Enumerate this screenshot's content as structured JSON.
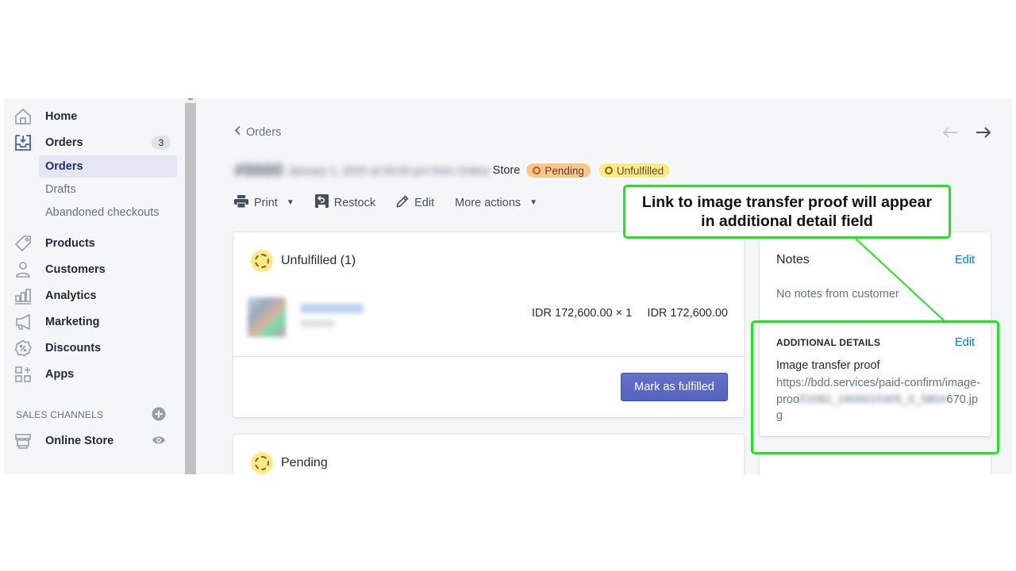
{
  "sidebar": {
    "items": [
      {
        "label": "Home",
        "icon": "home-icon"
      },
      {
        "label": "Orders",
        "icon": "orders-icon",
        "badge": "3"
      },
      {
        "label": "Products",
        "icon": "tag-icon"
      },
      {
        "label": "Customers",
        "icon": "person-icon"
      },
      {
        "label": "Analytics",
        "icon": "bar-chart-icon"
      },
      {
        "label": "Marketing",
        "icon": "megaphone-icon"
      },
      {
        "label": "Discounts",
        "icon": "discount-icon"
      },
      {
        "label": "Apps",
        "icon": "apps-icon"
      }
    ],
    "orders_sub": [
      {
        "label": "Orders"
      },
      {
        "label": "Drafts"
      },
      {
        "label": "Abandoned checkouts"
      }
    ],
    "sales_channels_title": "SALES CHANNELS",
    "online_store": "Online Store"
  },
  "header": {
    "breadcrumb": "Orders",
    "order_number_blurred": "#0000",
    "order_date_blurred": "January 1, 2020 at 00:00 pm from Online",
    "store_suffix": "Store",
    "statuses": [
      "Pending",
      "Unfulfilled"
    ]
  },
  "actions": {
    "print": "Print",
    "restock": "Restock",
    "edit": "Edit",
    "more": "More actions"
  },
  "unfulfilled": {
    "title": "Unfulfilled (1)",
    "item_price": "IDR 172,600.00 × 1",
    "item_total": "IDR 172,600.00",
    "button": "Mark as fulfilled"
  },
  "pending": {
    "title": "Pending"
  },
  "notes": {
    "title": "Notes",
    "edit": "Edit",
    "body": "No notes from customer"
  },
  "additional": {
    "title": "ADDITIONAL DETAILS",
    "edit": "Edit",
    "label": "Image transfer proof",
    "url_prefix": "https://bdd.services/paid-confirm/image-proo",
    "url_blurred": "f/1082_1600015305_0_5804",
    "url_suffix": "670.jpg"
  },
  "annotation": {
    "text": "Link to image transfer proof will appear in additional detail field",
    "color": "#22e322"
  },
  "colors": {
    "accent": "#5c6ac4",
    "link": "#007ace",
    "pending_badge": "#ffc58b",
    "unfulfilled_badge": "#ffea8a"
  }
}
